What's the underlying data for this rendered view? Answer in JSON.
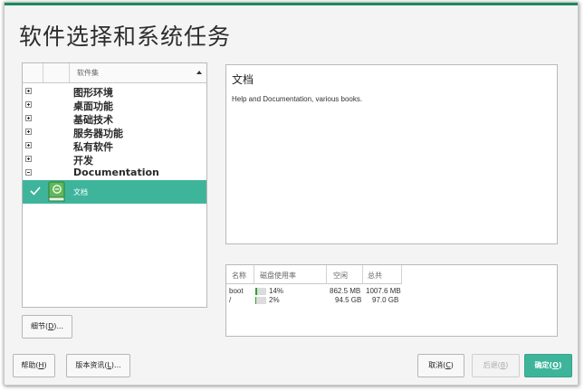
{
  "page_title": "软件选择和系统任务",
  "pattern_list": {
    "header_label": "软件集",
    "groups": [
      {
        "label": "图形环境",
        "expanded": false
      },
      {
        "label": "桌面功能",
        "expanded": false
      },
      {
        "label": "基础技术",
        "expanded": false
      },
      {
        "label": "服务器功能",
        "expanded": false
      },
      {
        "label": "私有软件",
        "expanded": false
      },
      {
        "label": "开发",
        "expanded": false
      },
      {
        "label": "Documentation",
        "expanded": true
      }
    ],
    "selected_item": {
      "label": "文档",
      "checked": true,
      "icon": "book-icon"
    }
  },
  "description": {
    "title": "文档",
    "text": "Help and Documentation, various books."
  },
  "disk_usage": {
    "columns": [
      "名称",
      "磁盘使用率",
      "空闲",
      "总共"
    ],
    "rows": [
      {
        "name": "boot",
        "usage_pct": 14,
        "usage_label": "14%",
        "free": "862.5 MB",
        "total": "1007.6 MB"
      },
      {
        "name": "/",
        "usage_pct": 2,
        "usage_label": "2%",
        "free": "94.5 GB",
        "total": "97.0 GB"
      }
    ]
  },
  "buttons": {
    "details": {
      "label": "细节(",
      "key": "D",
      "tail": ")..."
    },
    "help": {
      "label": "帮助(",
      "key": "H",
      "tail": ")"
    },
    "release_notes": {
      "label": "版本资讯(",
      "key": "L",
      "tail": ")..."
    },
    "cancel": {
      "label": "取消(",
      "key": "C",
      "tail": ")"
    },
    "back": {
      "label": "后退(",
      "key": "B",
      "tail": ")"
    },
    "ok": {
      "label": "确定(",
      "key": "O",
      "tail": ")"
    }
  },
  "colors": {
    "accent": "#3eb59b",
    "brand_bar": "#1b8a5e",
    "usage_fill": "#2da32d"
  }
}
